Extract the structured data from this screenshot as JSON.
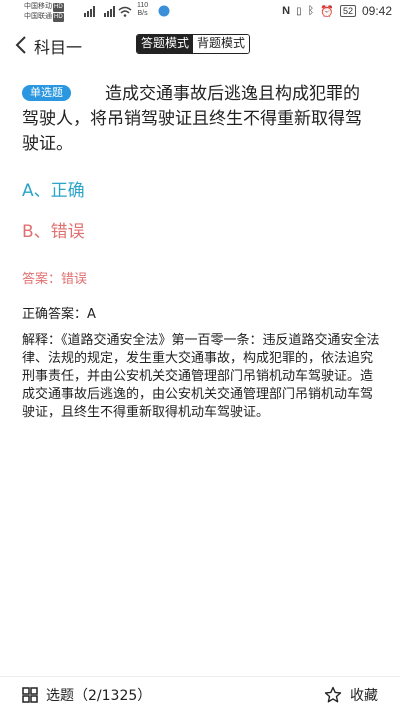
{
  "status": {
    "carrier1": "中国移动",
    "carrier2": "中国联通",
    "hd": "HD",
    "net1": "4G",
    "net2": "4G",
    "speed_value": "110",
    "speed_unit": "B/s",
    "battery": "52",
    "time": "09:42"
  },
  "header": {
    "title": "科目一",
    "modes": [
      "答题模式",
      "背题模式"
    ]
  },
  "question": {
    "type_badge": "单选题",
    "text": "造成交通事故后逃逸且构成犯罪的驾驶人，将吊销驾驶证且终生不得重新取得驾驶证。",
    "options": [
      "A、正确",
      "B、错误"
    ]
  },
  "answer": {
    "user_answer": "答案：错误",
    "correct_answer": "正确答案：A",
    "explanation": "解释：《道路交通安全法》第一百零一条：违反道路交通安全法律、法规的规定，发生重大交通事故，构成犯罪的，依法追究刑事责任，并由公安机关交通管理部门吊销机动车驾驶证。造成交通事故后逃逸的，由公安机关交通管理部门吊销机动车驾驶证，且终生不得重新取得机动车驾驶证。"
  },
  "bottom": {
    "select_label": "选题（2/1325）",
    "favorite_label": "收藏"
  },
  "colors": {
    "badge": "#2a97e0",
    "correct_option": "#2aa3c9",
    "wrong_option": "#e07070"
  }
}
